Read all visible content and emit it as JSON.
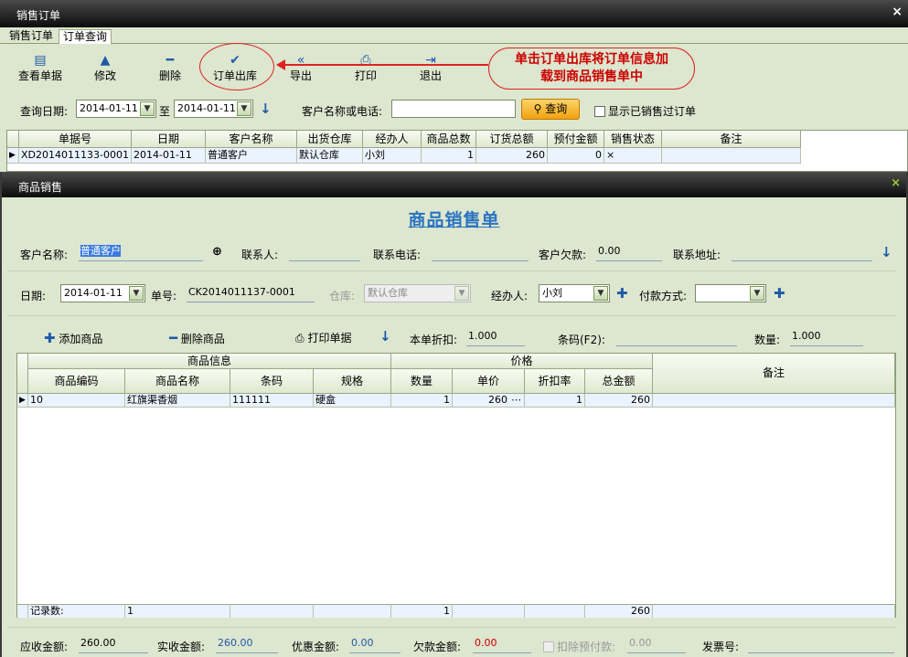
{
  "window": {
    "title": "销售订单",
    "close": "×"
  },
  "tabs": [
    "销售订单",
    "订单查询"
  ],
  "toolbar": {
    "view": "查看单据",
    "edit": "修改",
    "delete": "删除",
    "checkout": "订单出库",
    "export": "导出",
    "print": "打印",
    "exit": "退出"
  },
  "callout": {
    "line1": "单击订单出库将订单信息加",
    "line2": "载到商品销售单中"
  },
  "query": {
    "date_label": "查询日期:",
    "date_from": "2014-01-11",
    "to": "至",
    "date_to": "2014-01-11",
    "customer_label": "客户名称或电话:",
    "customer_value": "",
    "search": "查询",
    "show_sold": "显示已销售过订单"
  },
  "orders": {
    "columns": [
      "单据号",
      "日期",
      "客户名称",
      "出货仓库",
      "经办人",
      "商品总数",
      "订货总额",
      "预付金额",
      "销售状态",
      "备注"
    ],
    "rows": [
      [
        "XD2014011133-0001",
        "2014-01-11",
        "普通客户",
        "默认仓库",
        "小刘",
        "1",
        "260",
        "0",
        "×",
        ""
      ]
    ]
  },
  "sale": {
    "title": "商品销售",
    "close": "×",
    "form_title": "商品销售单",
    "customer_label": "客户名称:",
    "customer": "普通客户",
    "contact_label": "联系人:",
    "contact": "",
    "phone_label": "联系电话:",
    "phone": "",
    "debt_label": "客户欠款:",
    "debt": "0.00",
    "address_label": "联系地址:",
    "address": "",
    "date_label": "日期:",
    "date": "2014-01-11",
    "no_label": "单号:",
    "no": "CK2014011137-0001",
    "warehouse_label": "仓库:",
    "warehouse": "默认仓库",
    "handler_label": "经办人:",
    "handler": "小刘",
    "pay_label": "付款方式:",
    "pay": "",
    "add": "添加商品",
    "remove": "删除商品",
    "print": "打印单据",
    "discount_label": "本单折扣:",
    "discount": "1.000",
    "barcode_label": "条码(F2):",
    "barcode": "",
    "qty_label": "数量:",
    "qty": "1.000",
    "groups": {
      "info": "商品信息",
      "price": "价格",
      "note": "备注"
    },
    "columns": [
      "商品编码",
      "商品名称",
      "条码",
      "规格",
      "数量",
      "单价",
      "折扣率",
      "总金额"
    ],
    "rows": [
      [
        "10",
        "红旗渠香烟",
        "111111",
        "硬盒",
        "1",
        "260",
        "1",
        "260"
      ]
    ],
    "footer": {
      "label": "记录数:",
      "count": "1",
      "qty": "1",
      "total": "260"
    },
    "totals": {
      "receivable_label": "应收金额:",
      "receivable": "260.00",
      "actual_label": "实收金额:",
      "actual": "260.00",
      "discount_label": "优惠金额:",
      "discount": "0.00",
      "owed_label": "欠款金额:",
      "owed": "0.00",
      "prepaid_label": "扣除预付款:",
      "prepaid": "0.00",
      "invoice_label": "发票号:",
      "invoice": ""
    }
  },
  "colors": {
    "accent": "#2a74c0",
    "callout": "#d22222",
    "owed": "#cc0000"
  }
}
